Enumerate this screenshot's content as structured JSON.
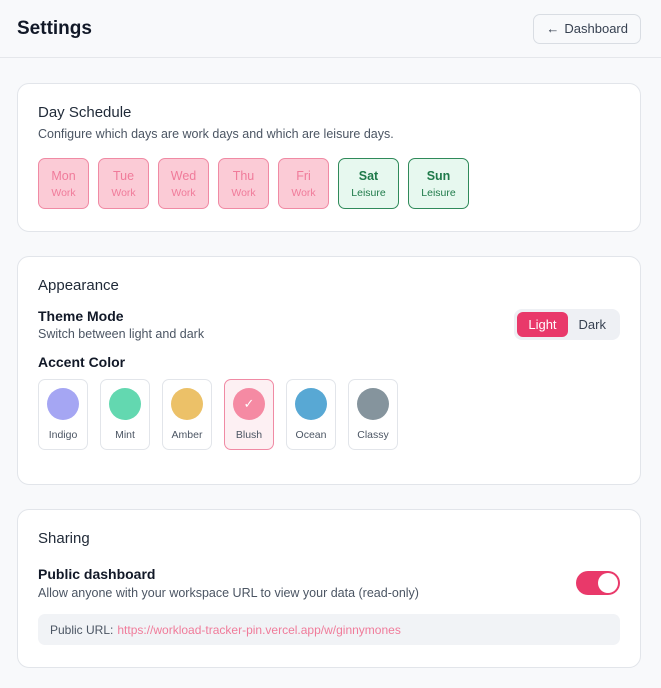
{
  "header": {
    "title": "Settings",
    "dashboard_button": "Dashboard",
    "dashboard_icon": "arrow-left-icon"
  },
  "schedule": {
    "title": "Day Schedule",
    "description": "Configure which days are work days and which are leisure days.",
    "days": [
      {
        "name": "Mon",
        "type": "Work"
      },
      {
        "name": "Tue",
        "type": "Work"
      },
      {
        "name": "Wed",
        "type": "Work"
      },
      {
        "name": "Thu",
        "type": "Work"
      },
      {
        "name": "Fri",
        "type": "Work"
      },
      {
        "name": "Sat",
        "type": "Leisure"
      },
      {
        "name": "Sun",
        "type": "Leisure"
      }
    ]
  },
  "appearance": {
    "title": "Appearance",
    "theme_title": "Theme Mode",
    "theme_desc": "Switch between light and dark",
    "theme_light": "Light",
    "theme_dark": "Dark",
    "theme_selected": "Light",
    "accent_title": "Accent Color",
    "accents": [
      {
        "name": "Indigo",
        "color": "#a5a6f3"
      },
      {
        "name": "Mint",
        "color": "#63d8b0"
      },
      {
        "name": "Amber",
        "color": "#ecc168"
      },
      {
        "name": "Blush",
        "color": "#f58aa3",
        "selected": true
      },
      {
        "name": "Ocean",
        "color": "#58a8d4"
      },
      {
        "name": "Classy",
        "color": "#85949d"
      }
    ],
    "check_glyph": "✓"
  },
  "sharing": {
    "title": "Sharing",
    "public_title": "Public dashboard",
    "public_desc": "Allow anyone with your workspace URL to view your data (read-only)",
    "public_enabled": true,
    "url_label": "Public URL:",
    "url_value": "https://workload-tracker-pin.vercel.app/w/ginnymones"
  },
  "colors": {
    "accent": "#e9396a",
    "work_bg": "#fbcbd6",
    "leisure_bg": "#e7f8ef",
    "leisure_border": "#2f8a5a"
  }
}
